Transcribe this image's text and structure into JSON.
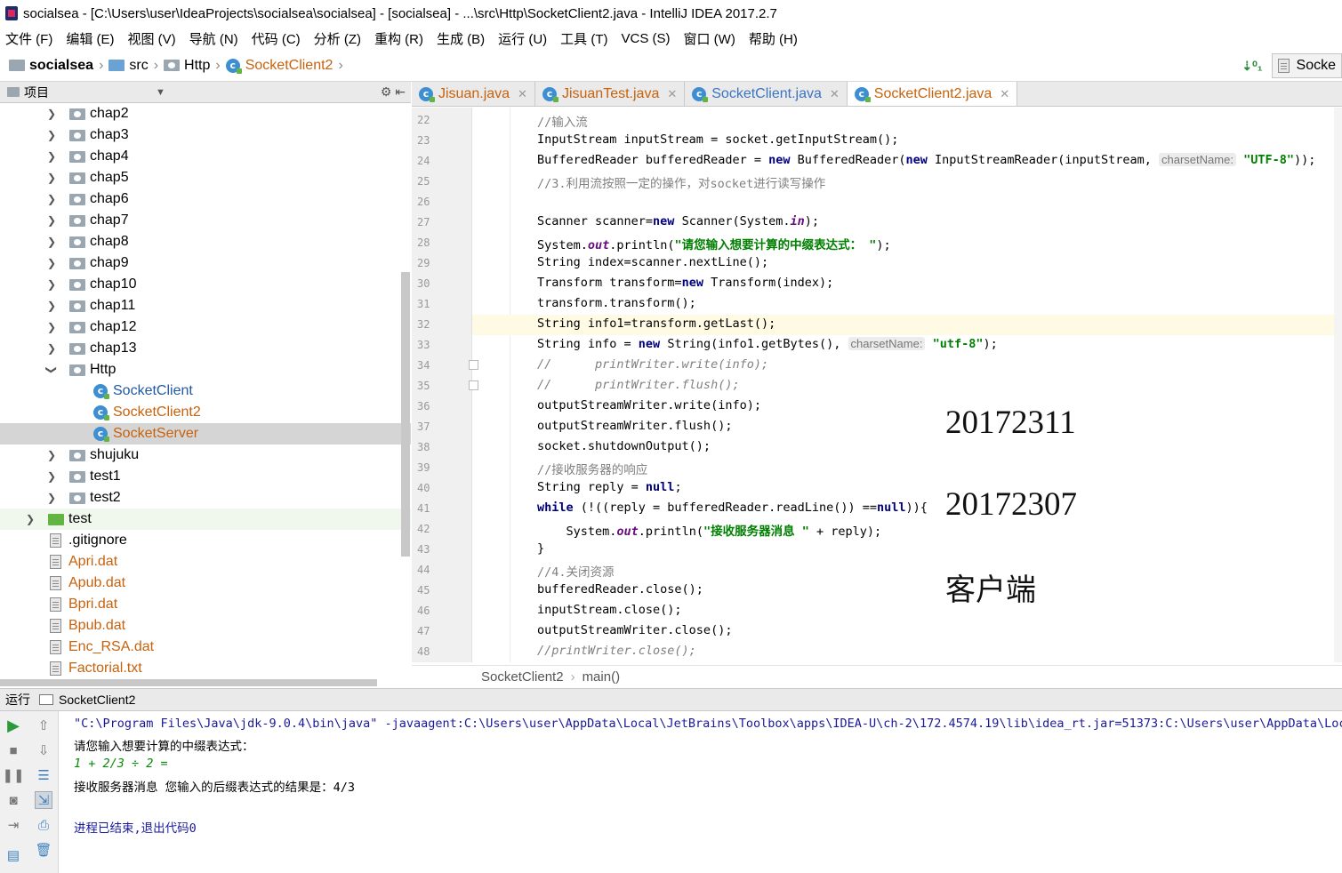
{
  "window": {
    "title": "socialsea - [C:\\Users\\user\\IdeaProjects\\socialsea\\socialsea] - [socialsea] - ...\\src\\Http\\SocketClient2.java - IntelliJ IDEA 2017.2.7"
  },
  "menu": {
    "items": [
      "文件 (F)",
      "编辑 (E)",
      "视图 (V)",
      "导航 (N)",
      "代码 (C)",
      "分析 (Z)",
      "重构 (R)",
      "生成 (B)",
      "运行 (U)",
      "工具 (T)",
      "VCS (S)",
      "窗口 (W)",
      "帮助 (H)"
    ]
  },
  "breadcrumb": {
    "project": "socialsea",
    "src": "src",
    "pkg": "Http",
    "file": "SocketClient2"
  },
  "run_config": {
    "label": "Socke"
  },
  "project_panel": {
    "title": "项目",
    "tools": "⚙ ⇤",
    "tree": [
      {
        "label": "chap2",
        "kind": "package"
      },
      {
        "label": "chap3",
        "kind": "package"
      },
      {
        "label": "chap4",
        "kind": "package"
      },
      {
        "label": "chap5",
        "kind": "package"
      },
      {
        "label": "chap6",
        "kind": "package"
      },
      {
        "label": "chap7",
        "kind": "package"
      },
      {
        "label": "chap8",
        "kind": "package"
      },
      {
        "label": "chap9",
        "kind": "package"
      },
      {
        "label": "chap10",
        "kind": "package"
      },
      {
        "label": "chap11",
        "kind": "package"
      },
      {
        "label": "chap12",
        "kind": "package"
      },
      {
        "label": "chap13",
        "kind": "package"
      },
      {
        "label": "Http",
        "kind": "package"
      },
      {
        "label": "SocketClient",
        "kind": "class"
      },
      {
        "label": "SocketClient2",
        "kind": "class"
      },
      {
        "label": "SocketServer",
        "kind": "class"
      },
      {
        "label": "shujuku",
        "kind": "package"
      },
      {
        "label": "test1",
        "kind": "package"
      },
      {
        "label": "test2",
        "kind": "package"
      },
      {
        "label": "test",
        "kind": "folder"
      },
      {
        "label": ".gitignore",
        "kind": "file"
      },
      {
        "label": "Apri.dat",
        "kind": "file"
      },
      {
        "label": "Apub.dat",
        "kind": "file"
      },
      {
        "label": "Bpri.dat",
        "kind": "file"
      },
      {
        "label": "Bpub.dat",
        "kind": "file"
      },
      {
        "label": "Enc_RSA.dat",
        "kind": "file"
      },
      {
        "label": "Factorial.txt",
        "kind": "file"
      }
    ]
  },
  "tabs": [
    {
      "label": "Jisuan.java"
    },
    {
      "label": "JisuanTest.java"
    },
    {
      "label": "SocketClient.java"
    },
    {
      "label": "SocketClient2.java"
    }
  ],
  "editor": {
    "line_numbers": [
      "22",
      "23",
      "24",
      "25",
      "26",
      "27",
      "28",
      "29",
      "30",
      "31",
      "32",
      "33",
      "34",
      "35",
      "36",
      "37",
      "38",
      "39",
      "40",
      "41",
      "42",
      "43",
      "44",
      "45",
      "46",
      "47",
      "48"
    ],
    "code": {
      "l22": "//输入流",
      "l23": "InputStream inputStream = socket.getInputStream();",
      "l24a": "BufferedReader bufferedReader = ",
      "l24b": "new",
      "l24c": " BufferedReader(",
      "l24d": "new",
      "l24e": " InputStreamReader(inputStream, ",
      "l24hint": "charsetName:",
      "l24str": "\"UTF-8\"",
      "l24f": "));",
      "l25": "//3.利用流按照一定的操作，对socket进行读写操作",
      "l27a": "Scanner scanner=",
      "l27b": "new",
      "l27c": " Scanner(System.",
      "l27d": "in",
      "l27e": ");",
      "l28a": "System.",
      "l28b": "out",
      "l28c": ".println(",
      "l28str": "\"请您输入想要计算的中缀表达式： \"",
      "l28d": ");",
      "l29": "String index=scanner.nextLine();",
      "l30a": "Transform transform=",
      "l30b": "new",
      "l30c": " Transform(index);",
      "l31": "transform.transform();",
      "l32": "String info1=transform.getLast();",
      "l33a": "String info = ",
      "l33b": "new",
      "l33c": " String(info1.getBytes(), ",
      "l33hint": "charsetName:",
      "l33str": "\"utf-8\"",
      "l33d": ");",
      "l34": "//      printWriter.write(info);",
      "l35": "//      printWriter.flush();",
      "l36": "outputStreamWriter.write(info);",
      "l37": "outputStreamWriter.flush();",
      "l38": "socket.shutdownOutput();",
      "l39": "//接收服务器的响应",
      "l40a": "String reply = ",
      "l40b": "null",
      "l40c": ";",
      "l41a": "while",
      "l41b": " (!((reply = bufferedReader.readLine()) ==",
      "l41c": "null",
      "l41d": ")){",
      "l42a": "    System.",
      "l42b": "out",
      "l42c": ".println(",
      "l42str": "\"接收服务器消息 \"",
      "l42d": " + reply);",
      "l43": "}",
      "l44": "//4.关闭资源",
      "l45": "bufferedReader.close();",
      "l46": "inputStream.close();",
      "l47": "outputStreamWriter.close();",
      "l48": "//printWriter.close();"
    },
    "annotations": {
      "id1": "20172311",
      "id2": "20172307",
      "role": "客户端"
    },
    "status": {
      "cls": "SocketClient2",
      "method": "main()"
    }
  },
  "run_panel": {
    "label": "运行",
    "config": "SocketClient2",
    "console": [
      "\"C:\\Program Files\\Java\\jdk-9.0.4\\bin\\java\" -javaagent:C:\\Users\\user\\AppData\\Local\\JetBrains\\Toolbox\\apps\\IDEA-U\\ch-2\\172.4574.19\\lib\\idea_rt.jar=51373:C:\\Users\\user\\AppData\\Local",
      "请您输入想要计算的中缀表达式：",
      "1 + 2/3 ÷ 2 =",
      "接收服务器消息 您输入的后缀表达式的结果是：4/3",
      "进程已结束,退出代码0"
    ]
  },
  "colors": {
    "keyword": "#000080",
    "string": "#008000",
    "comment": "#808080",
    "current_line": "#fffae3",
    "selection": "#d5d5d5"
  }
}
